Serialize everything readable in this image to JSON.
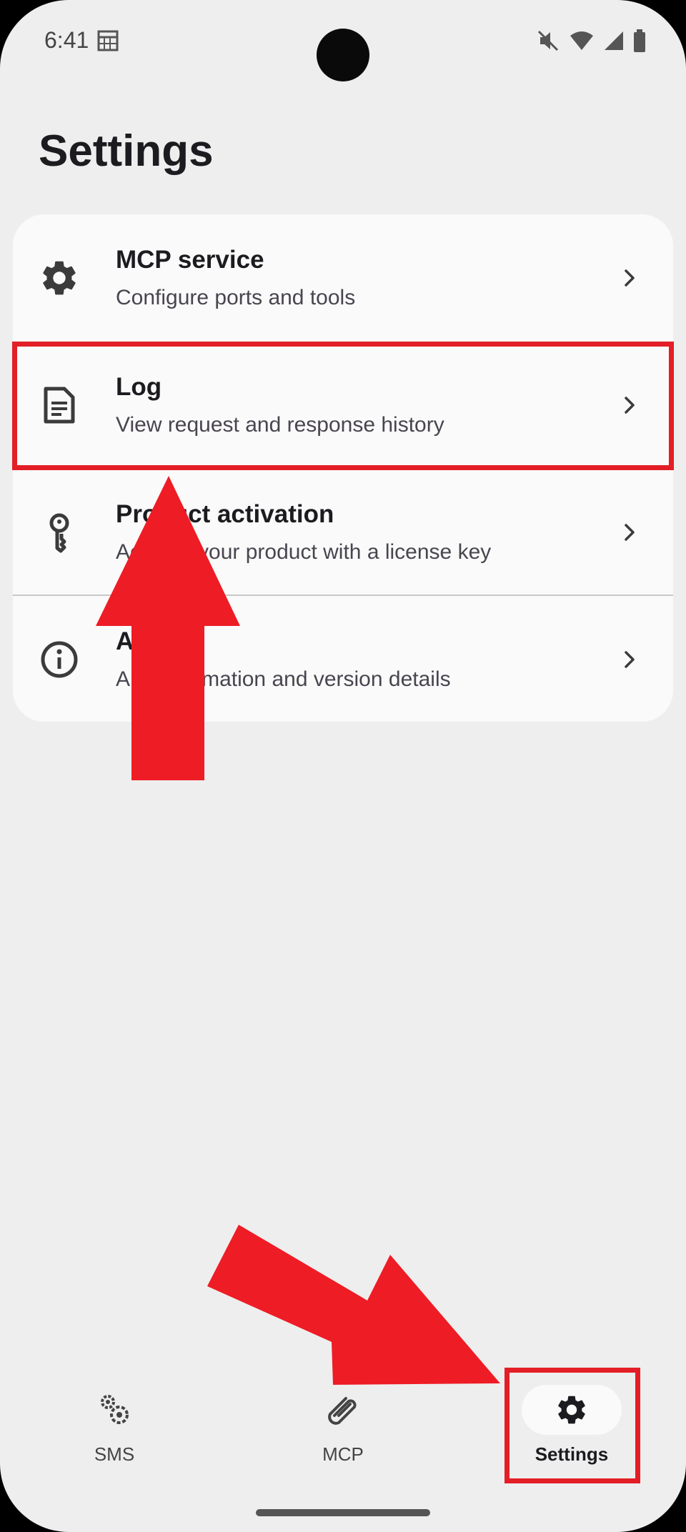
{
  "status_bar": {
    "time": "6:41",
    "icons": [
      "calendar-icon",
      "mute-icon",
      "wifi-icon",
      "signal-icon",
      "battery-icon"
    ]
  },
  "page": {
    "title": "Settings"
  },
  "settings_list": [
    {
      "icon": "gear-icon",
      "title": "MCP service",
      "subtitle": "Configure ports and tools"
    },
    {
      "icon": "document-icon",
      "title": "Log",
      "subtitle": "View request and response history"
    },
    {
      "icon": "key-icon",
      "title": "Product activation",
      "subtitle": "Activate your product with a license key"
    },
    {
      "icon": "info-icon",
      "title": "About",
      "subtitle": "App information and version details"
    }
  ],
  "bottom_nav": {
    "items": [
      {
        "icon": "gears-icon",
        "label": "SMS"
      },
      {
        "icon": "paperclip-icon",
        "label": "MCP"
      },
      {
        "icon": "gear-icon",
        "label": "Settings",
        "selected": true
      }
    ]
  },
  "annotations": {
    "color": "#e31e26",
    "highlighted": [
      "Log",
      "Settings"
    ]
  }
}
